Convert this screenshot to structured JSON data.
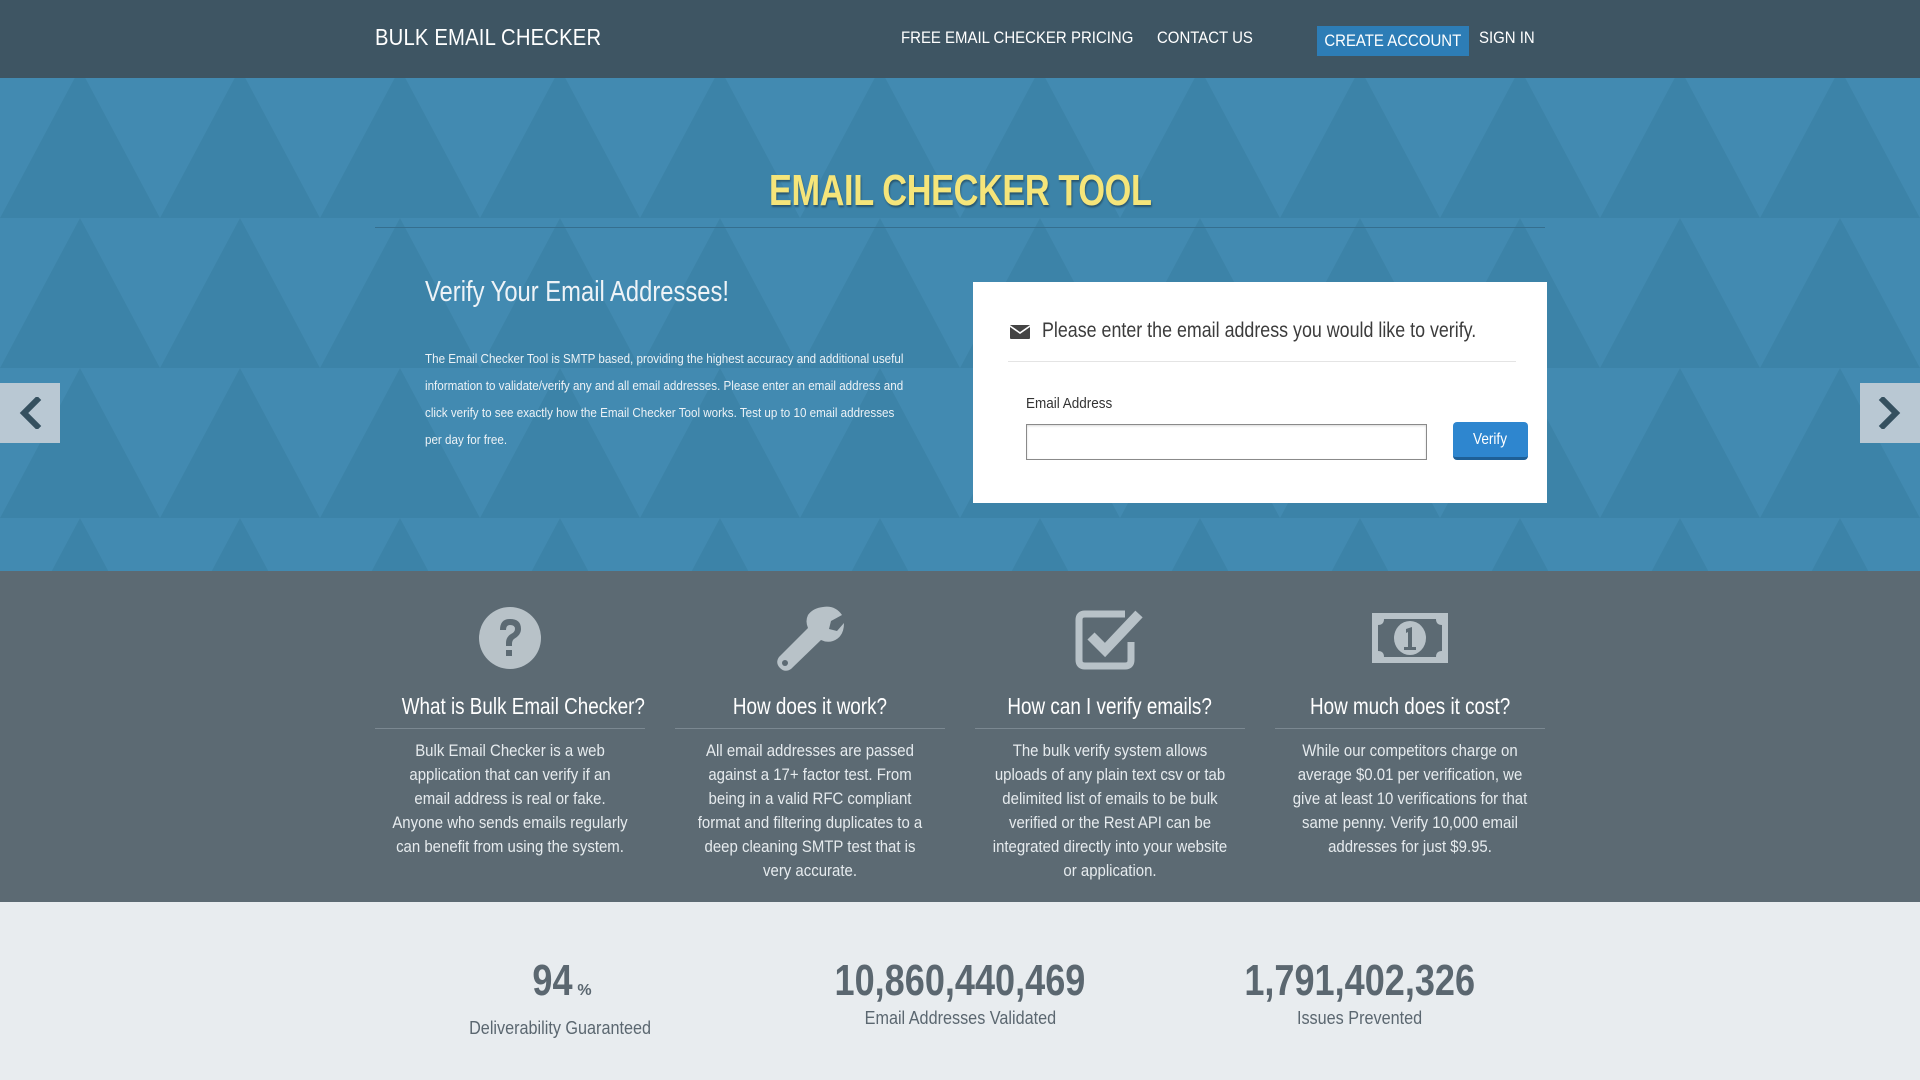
{
  "navbar": {
    "brand": "BULK EMAIL CHECKER",
    "links": {
      "free": "FREE EMAIL CHECKER",
      "pricing": "PRICING",
      "contact": "CONTACT US",
      "create_account": "CREATE ACCOUNT",
      "sign_in": "SIGN IN"
    }
  },
  "hero": {
    "title": "EMAIL CHECKER TOOL",
    "subtitle": "Verify Your Email Addresses!",
    "description": "The Email Checker Tool is SMTP based, providing the highest accuracy and additional useful information to validate/verify any and all email addresses. Please enter an email address and click verify to see exactly how the Email Checker Tool works. Test up to 10 email addresses per day for free.",
    "prev_icon": "chevron-left-icon",
    "next_icon": "chevron-right-icon"
  },
  "form": {
    "prompt": "Please enter the email address you would like to verify.",
    "prompt_icon": "envelope-icon",
    "email_label": "Email Address",
    "email_value": "",
    "email_placeholder": "",
    "verify_label": "Verify"
  },
  "features": [
    {
      "icon": "question-circle-icon",
      "title": "What is Bulk Email Checker?",
      "text": "Bulk Email Checker is a web application that can verify if an email address is real or fake. Anyone who sends emails regularly can benefit from using the system."
    },
    {
      "icon": "wrench-icon",
      "title": "How does it work?",
      "text": "All email addresses are passed against a 17+ factor test. From being in a valid RFC compliant format and filtering duplicates to a deep cleaning SMTP test that is very accurate."
    },
    {
      "icon": "checkbox-icon",
      "title": "How can I verify emails?",
      "text": "The bulk verify system allows uploads of any plain text csv or tab delimited list of emails to be bulk verified or the Rest API can be integrated directly into your website or application."
    },
    {
      "icon": "money-bill-icon",
      "title": "How much does it cost?",
      "text": "While our competitors charge on average $0.01 per verification, we give at least 10 verifications for that same penny. Verify 10,000 email addresses for just $9.95."
    }
  ],
  "stats": [
    {
      "value": "94",
      "unit": "%",
      "label": "Deliverability Guaranteed"
    },
    {
      "value": "10,860,440,469",
      "label": "Email Addresses Validated"
    },
    {
      "value": "1,791,402,326",
      "label": "Issues Prevented"
    }
  ],
  "colors": {
    "navbar": "#3e5563",
    "hero": "#3f87ad",
    "title_accent": "#f5e57a",
    "button_primary": "#2e86cf",
    "features_bg": "#5c6a73",
    "stats_bg": "#e8ecef"
  }
}
